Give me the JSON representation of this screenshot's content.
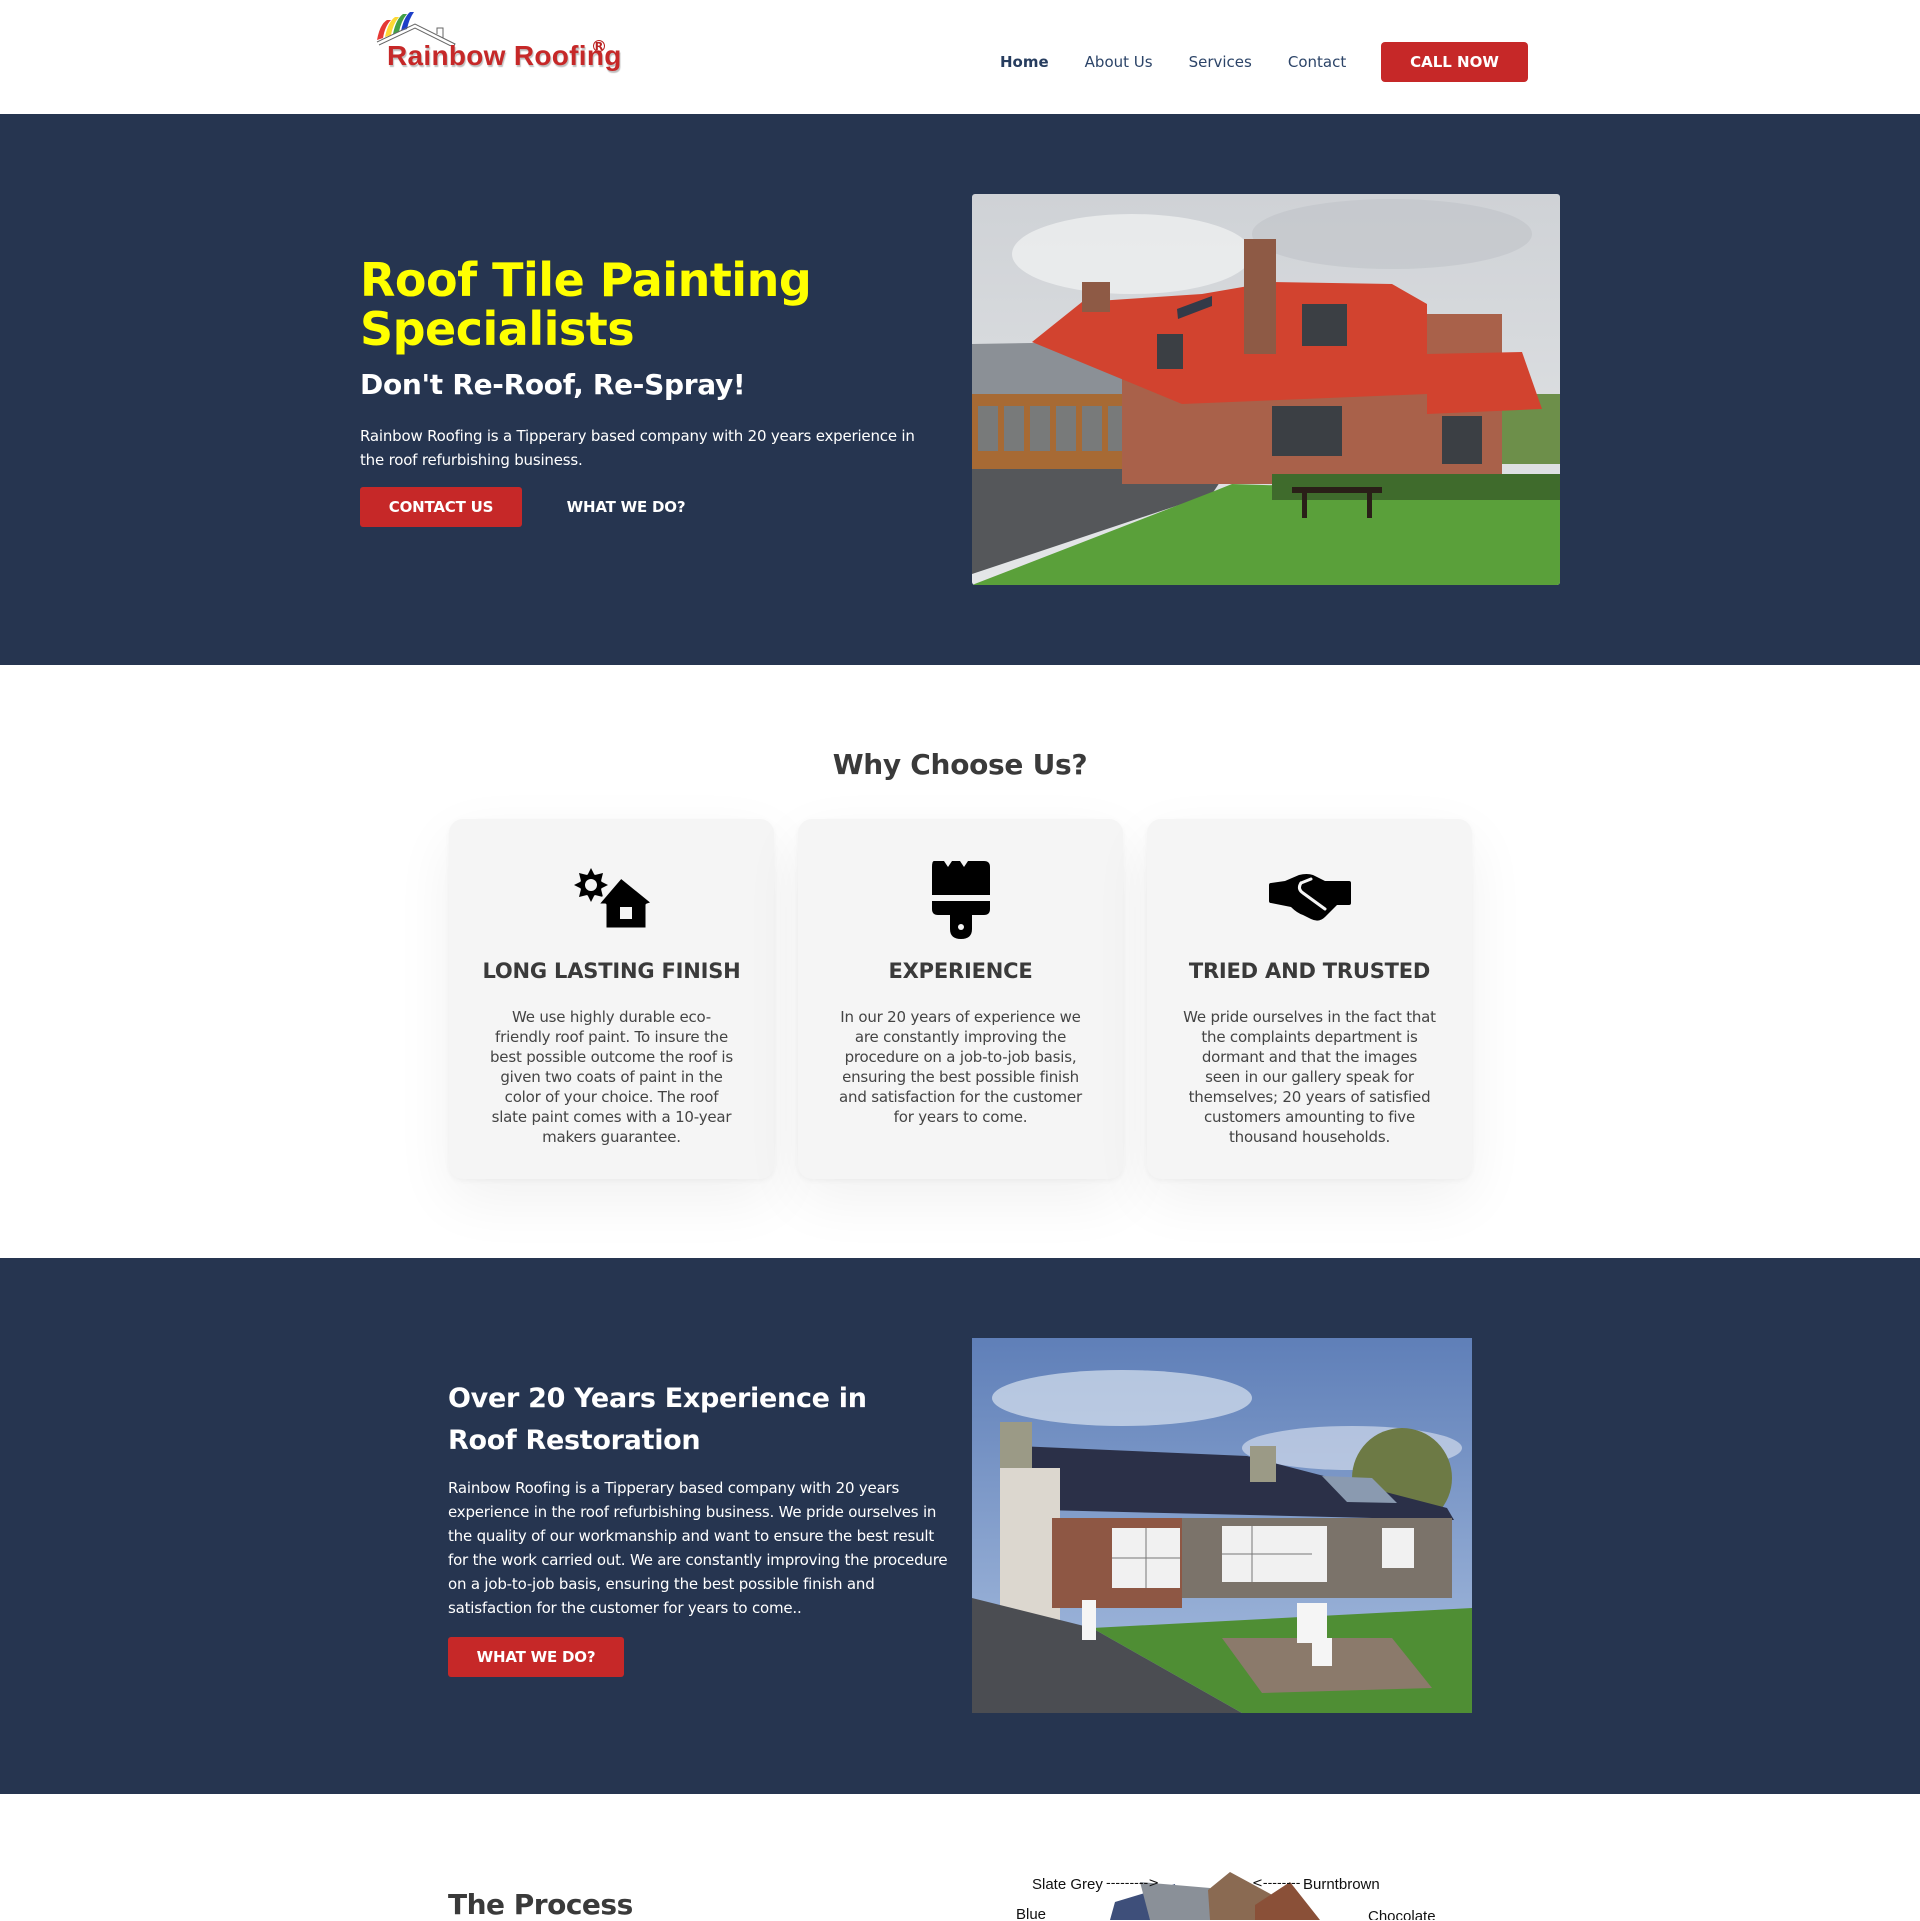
{
  "header": {
    "logo_text": "Rainbow Roofing",
    "logo_reg": "R",
    "nav": [
      {
        "label": "Home",
        "active": true
      },
      {
        "label": "About Us",
        "active": false
      },
      {
        "label": "Services",
        "active": false
      },
      {
        "label": "Contact",
        "active": false
      }
    ],
    "cta_label": "CALL NOW"
  },
  "hero": {
    "title": "Roof Tile Painting Specialists",
    "subtitle": "Don't Re-Roof, Re-Spray!",
    "description": "Rainbow Roofing is a Tipperary based company with 20 years experience in the roof refurbishing business.",
    "primary_button": "CONTACT US",
    "secondary_button": "WHAT WE DO?",
    "image_alt": "House with freshly painted red roof tiles"
  },
  "why": {
    "title": "Why Choose Us?",
    "cards": [
      {
        "icon": "gear-house-icon",
        "title": "LONG LASTING FINISH",
        "text": "We use highly durable eco-friendly roof paint. To insure the best possible outcome the roof is given two coats of paint in the color of your choice. The roof slate paint comes with a 10-year makers guarantee."
      },
      {
        "icon": "paint-brush-icon",
        "title": "EXPERIENCE",
        "text": "In our 20 years of experience we are constantly improving the procedure on a job-to-job basis, ensuring the best possible finish and satisfaction for the customer for years to come."
      },
      {
        "icon": "handshake-icon",
        "title": "TRIED AND TRUSTED",
        "text": "We pride ourselves in the fact that the complaints department is dormant and that the images seen in our gallery speak for themselves; 20 years of satisfied customers amounting to five thousand households."
      }
    ]
  },
  "experience": {
    "title": "Over 20 Years Experience in Roof Restoration",
    "description": "Rainbow Roofing is a Tipperary based company with 20 years experience in the roof refurbishing business. We pride ourselves in the quality of our workmanship and want to ensure the best result for the work carried out. We are constantly improving the procedure on a job-to-job basis, ensuring the best possible finish and satisfaction for the customer for years to come..",
    "button": "WHAT WE DO?",
    "image_alt": "Bungalow with dark painted roof"
  },
  "process": {
    "title": "The Process",
    "swatches": [
      "Slate Grey",
      "Burntbrown",
      "Blue",
      "Chocolate"
    ]
  },
  "colors": {
    "navy": "#263550",
    "accent_red": "#c62828",
    "headline_yellow": "#ffff00"
  }
}
